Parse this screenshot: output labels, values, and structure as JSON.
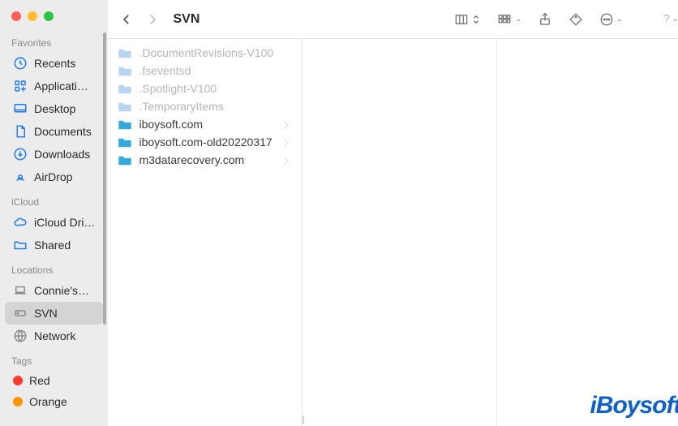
{
  "window_title": "SVN",
  "sidebar": {
    "groups": [
      {
        "label": "Favorites",
        "items": [
          {
            "label": "Recents",
            "icon": "clock-icon"
          },
          {
            "label": "Applicati…",
            "icon": "apps-icon"
          },
          {
            "label": "Desktop",
            "icon": "desktop-icon"
          },
          {
            "label": "Documents",
            "icon": "document-icon"
          },
          {
            "label": "Downloads",
            "icon": "download-icon"
          },
          {
            "label": "AirDrop",
            "icon": "airdrop-icon"
          }
        ]
      },
      {
        "label": "iCloud",
        "items": [
          {
            "label": "iCloud Dri…",
            "icon": "cloud-icon"
          },
          {
            "label": "Shared",
            "icon": "shared-folder-icon"
          }
        ]
      },
      {
        "label": "Locations",
        "items": [
          {
            "label": "Connie's…",
            "icon": "laptop-icon"
          },
          {
            "label": "SVN",
            "icon": "disk-icon",
            "selected": true
          },
          {
            "label": "Network",
            "icon": "network-icon"
          }
        ]
      },
      {
        "label": "Tags",
        "items": [
          {
            "label": "Red",
            "icon": "tag-red"
          },
          {
            "label": "Orange",
            "icon": "tag-orange"
          }
        ]
      }
    ]
  },
  "toolbar_icons": {
    "back_disabled": false,
    "forward_disabled": true
  },
  "column_items": [
    {
      "name": ".DocumentRevisions-V100",
      "hidden": true,
      "has_children": false
    },
    {
      "name": ".fseventsd",
      "hidden": true,
      "has_children": false
    },
    {
      "name": ".Spotlight-V100",
      "hidden": true,
      "has_children": false
    },
    {
      "name": ".TemporaryItems",
      "hidden": true,
      "has_children": false
    },
    {
      "name": "iboysoft.com",
      "hidden": false,
      "has_children": true
    },
    {
      "name": "iboysoft.com-old20220317",
      "hidden": false,
      "has_children": true
    },
    {
      "name": "m3datarecovery.com",
      "hidden": false,
      "has_children": true
    }
  ],
  "watermark": "iBoysoft"
}
